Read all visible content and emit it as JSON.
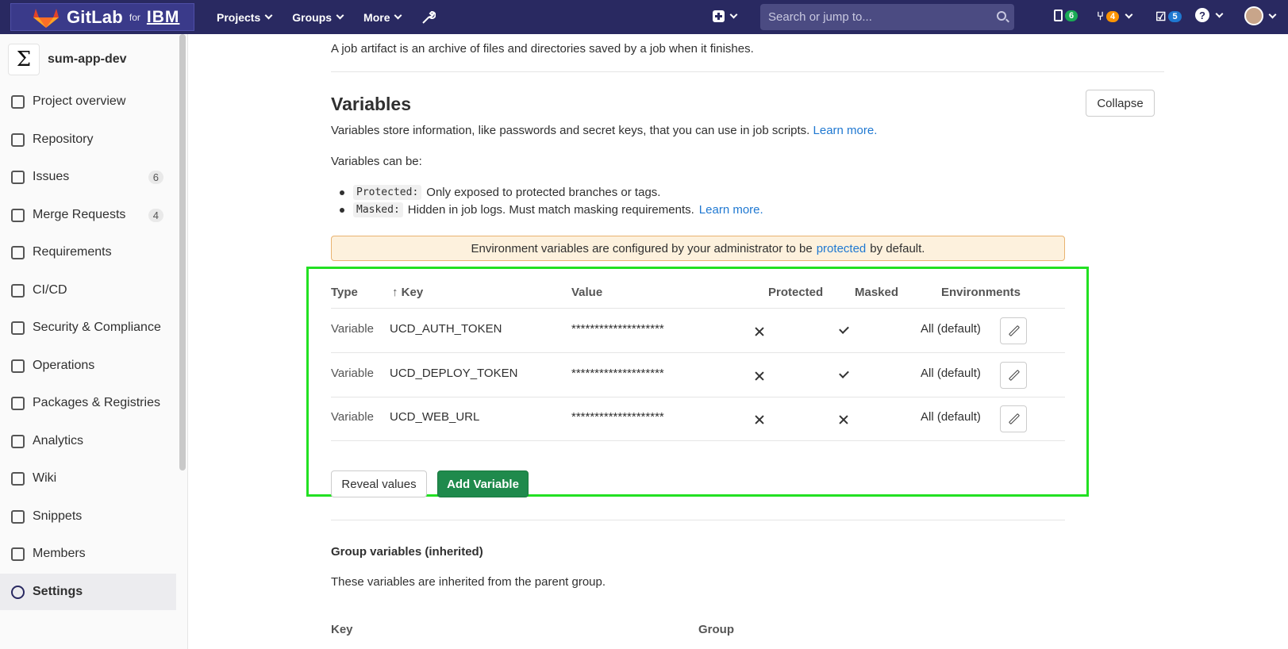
{
  "topbar": {
    "brand": "GitLab",
    "brand_for": "for",
    "brand_company": "IBM",
    "menu": [
      "Projects",
      "Groups",
      "More"
    ],
    "search_placeholder": "Search or jump to...",
    "counts": {
      "issues": "6",
      "merge_requests": "4",
      "todos": "5"
    },
    "icons": [
      "wrench-icon",
      "plus-square-icon",
      "issues-icon",
      "merge-request-icon",
      "todo-icon",
      "help-icon",
      "avatar"
    ]
  },
  "sidebar": {
    "project_avatar": "Σ",
    "project_name": "sum-app-dev",
    "items": [
      {
        "label": "Project overview",
        "icon": "home-icon"
      },
      {
        "label": "Repository",
        "icon": "doc-icon"
      },
      {
        "label": "Issues",
        "icon": "issues-icon",
        "badge": "6"
      },
      {
        "label": "Merge Requests",
        "icon": "merge-request-icon",
        "badge": "4"
      },
      {
        "label": "Requirements",
        "icon": "list-check-icon"
      },
      {
        "label": "CI/CD",
        "icon": "rocket-icon"
      },
      {
        "label": "Security & Compliance",
        "icon": "shield-icon"
      },
      {
        "label": "Operations",
        "icon": "cloud-gear-icon"
      },
      {
        "label": "Packages & Registries",
        "icon": "package-icon"
      },
      {
        "label": "Analytics",
        "icon": "chart-icon"
      },
      {
        "label": "Wiki",
        "icon": "book-icon"
      },
      {
        "label": "Snippets",
        "icon": "scissors-icon"
      },
      {
        "label": "Members",
        "icon": "users-icon"
      },
      {
        "label": "Settings",
        "icon": "gear-icon",
        "active": true
      }
    ]
  },
  "main": {
    "lede": "A job artifact is an archive of files and directories saved by a job when it finishes.",
    "title": "Variables",
    "collapse_label": "Collapse",
    "desc": "Variables store information, like passwords and secret keys, that you can use in job scripts.",
    "learn_more": "Learn more.",
    "can_be": "Variables can be:",
    "bullets": [
      {
        "code": "Protected:",
        "text": "Only exposed to protected branches or tags."
      },
      {
        "code": "Masked:",
        "text": "Hidden in job logs. Must match masking requirements.",
        "link": "Learn more."
      }
    ],
    "warning_pre": "Environment variables are configured by your administrator to be",
    "warning_link": "protected",
    "warning_post": "by default.",
    "table": {
      "headers": [
        "Type",
        "↑ Key",
        "Value",
        "Protected",
        "Masked",
        "Environments"
      ],
      "rows": [
        {
          "type": "Variable",
          "key": "UCD_AUTH_TOKEN",
          "value": "********************",
          "protected": false,
          "masked": true,
          "env": "All (default)"
        },
        {
          "type": "Variable",
          "key": "UCD_DEPLOY_TOKEN",
          "value": "********************",
          "protected": false,
          "masked": true,
          "env": "All (default)"
        },
        {
          "type": "Variable",
          "key": "UCD_WEB_URL",
          "value": "********************",
          "protected": false,
          "masked": false,
          "env": "All (default)"
        }
      ]
    },
    "reveal_label": "Reveal values",
    "add_label": "Add Variable",
    "group_title": "Group variables (inherited)",
    "group_desc": "These variables are inherited from the parent group.",
    "group_headers": [
      "Key",
      "Group"
    ]
  },
  "colors": {
    "topbar": "#292961",
    "accent_link": "#1f78d1",
    "add_button": "#1f8a4c",
    "highlight_frame": "#22e022",
    "warning_bg": "#fdf1dd"
  }
}
